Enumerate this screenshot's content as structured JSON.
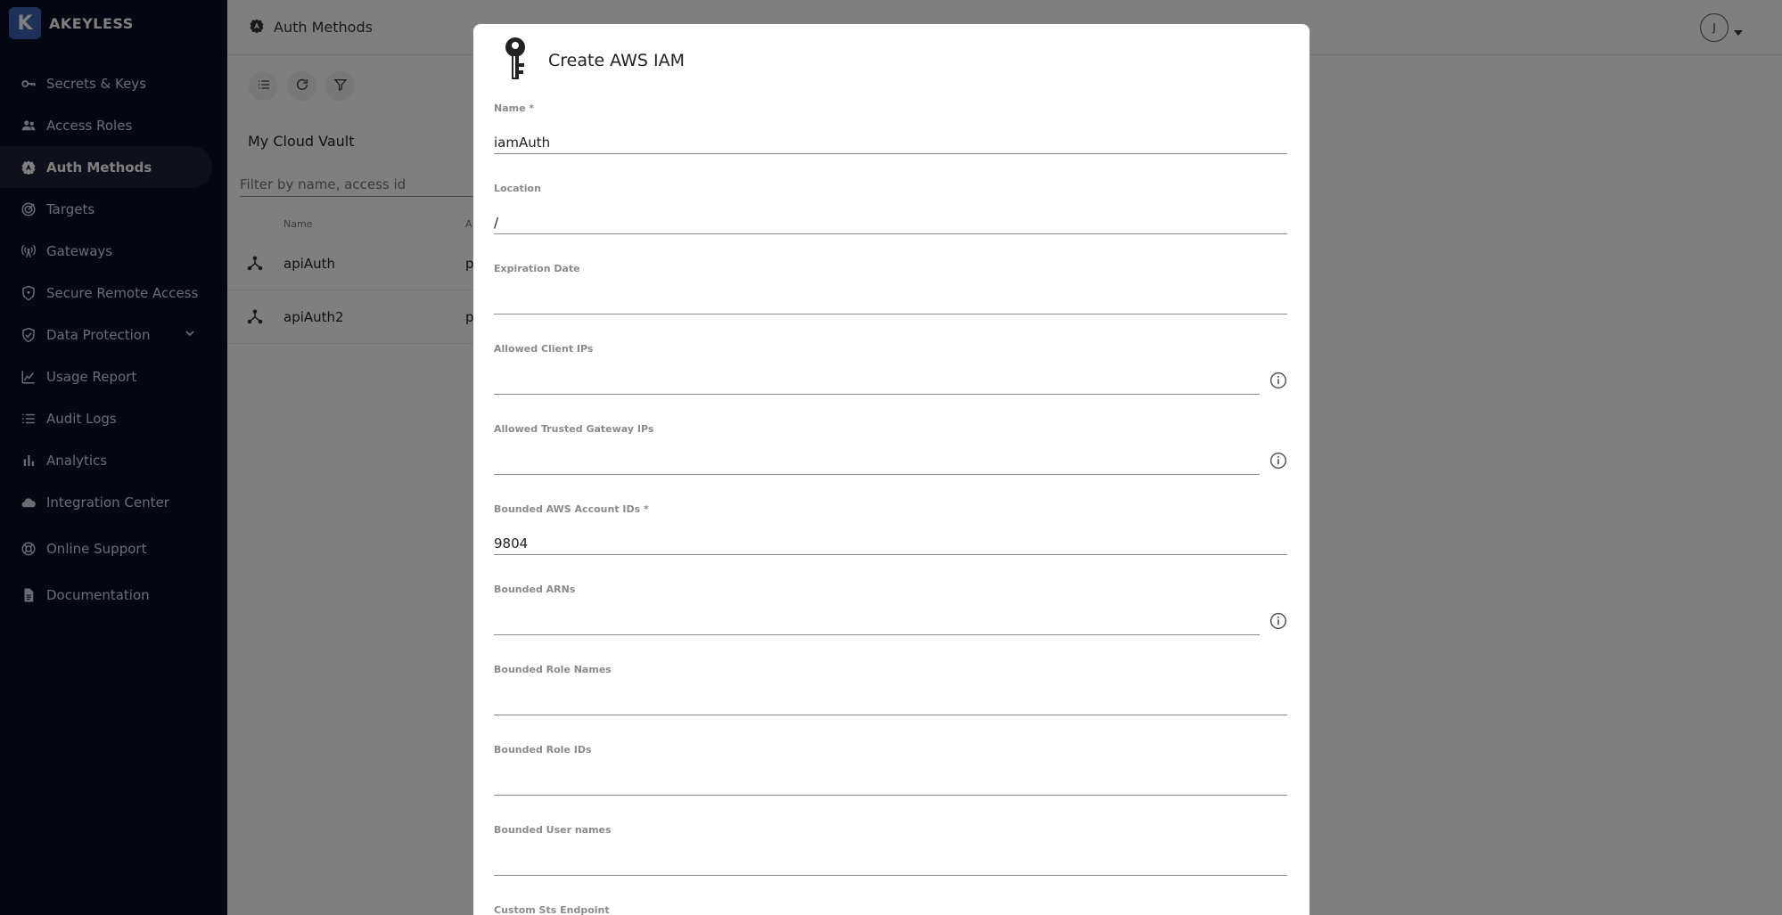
{
  "brand": {
    "logo_letter": "K",
    "name": "AKEYLESS",
    "logo_color": "#3b63b3"
  },
  "sidebar": {
    "items": [
      {
        "label": "Secrets & Keys",
        "icon": "key-icon"
      },
      {
        "label": "Access Roles",
        "icon": "people-icon"
      },
      {
        "label": "Auth Methods",
        "icon": "gear-shield-icon",
        "active": true
      },
      {
        "label": "Targets",
        "icon": "target-icon"
      },
      {
        "label": "Gateways",
        "icon": "antenna-icon"
      },
      {
        "label": "Secure Remote Access",
        "icon": "shield-icon"
      },
      {
        "label": "Data Protection",
        "icon": "shield-check-icon",
        "expandable": true
      },
      {
        "label": "Usage Report",
        "icon": "chart-icon"
      },
      {
        "label": "Audit Logs",
        "icon": "list-icon"
      },
      {
        "label": "Analytics",
        "icon": "bar-chart-icon"
      },
      {
        "label": "Integration Center",
        "icon": "cloud-icon"
      },
      {
        "label": "Online Support",
        "icon": "support-icon"
      },
      {
        "label": "Documentation",
        "icon": "document-icon"
      }
    ]
  },
  "topbar": {
    "title": "Auth Methods",
    "avatar_initial": "J"
  },
  "list": {
    "vault_name": "My Cloud Vault",
    "filter_placeholder": "Filter by name, access id",
    "columns": {
      "name": "Name",
      "second": "A"
    },
    "rows": [
      {
        "name": "apiAuth",
        "extra": "p"
      },
      {
        "name": "apiAuth2",
        "extra": "p"
      }
    ]
  },
  "modal": {
    "title": "Create AWS IAM",
    "fields": [
      {
        "label": "Name *",
        "value": "iamAuth"
      },
      {
        "label": "Location",
        "value": "/"
      },
      {
        "label": "Expiration Date",
        "value": ""
      },
      {
        "label": "Allowed Client IPs",
        "value": "",
        "info": true
      },
      {
        "label": "Allowed Trusted Gateway IPs",
        "value": "",
        "info": true
      },
      {
        "label": "Bounded AWS Account IDs *",
        "value": "9804"
      },
      {
        "label": "Bounded ARNs",
        "value": "",
        "info": true
      },
      {
        "label": "Bounded Role Names",
        "value": ""
      },
      {
        "label": "Bounded Role IDs",
        "value": ""
      },
      {
        "label": "Bounded User names",
        "value": ""
      },
      {
        "label": "Custom Sts Endpoint",
        "value": ""
      }
    ]
  }
}
